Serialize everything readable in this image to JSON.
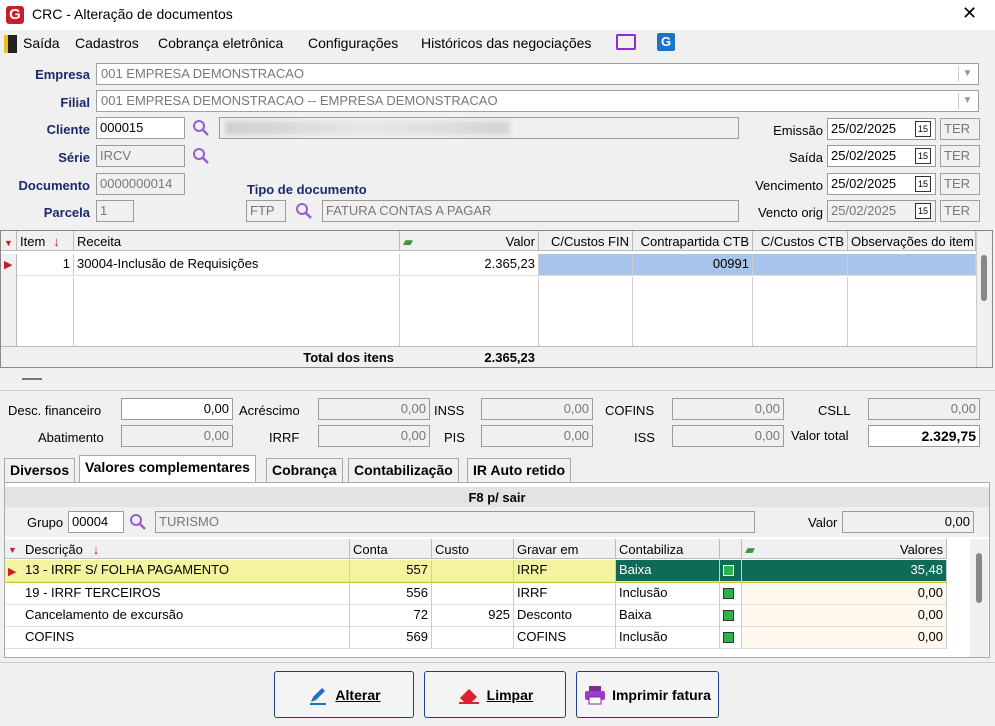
{
  "window": {
    "title": "CRC - Alteração de documentos",
    "logo": "G",
    "close": "✕"
  },
  "menu": {
    "items": [
      "Saída",
      "Cadastros",
      "Cobrança eletrônica",
      "Configurações",
      "Históricos das negociações"
    ]
  },
  "header": {
    "empresa_label": "Empresa",
    "empresa_value": "001 EMPRESA DEMONSTRACAO",
    "filial_label": "Filial",
    "filial_value": "001 EMPRESA DEMONSTRACAO -- EMPRESA DEMONSTRACAO",
    "cliente_label": "Cliente",
    "cliente_value": "000015",
    "serie_label": "Série",
    "serie_value": "IRCV",
    "documento_label": "Documento",
    "documento_value": "0000000014",
    "parcela_label": "Parcela",
    "parcela_value": "1",
    "tipo_doc_label": "Tipo de documento",
    "tipo_doc_code": "FTP",
    "tipo_doc_desc": "FATURA CONTAS A PAGAR",
    "emissao_label": "Emissão",
    "emissao_value": "25/02/2025",
    "emissao_day": "TER",
    "saida_label": "Saída",
    "saida_value": "25/02/2025",
    "saida_day": "TER",
    "vencimento_label": "Vencimento",
    "vencimento_value": "25/02/2025",
    "vencimento_day": "TER",
    "vencto_orig_label": "Vencto orig",
    "vencto_orig_value": "25/02/2025",
    "vencto_orig_day": "TER",
    "date_icon": "15"
  },
  "items_grid": {
    "columns": [
      "Item",
      "Receita",
      "Valor",
      "C/Custos FIN",
      "Contrapartida CTB",
      "C/Custos CTB",
      "Observações do item"
    ],
    "rows": [
      {
        "item": "1",
        "receita": "30004-Inclusão de Requisições",
        "valor": "2.365,23",
        "ccfin": "",
        "contrapartida": "00991",
        "ccctb": "",
        "obs": ""
      }
    ],
    "total_label": "Total dos itens",
    "total_value": "2.365,23"
  },
  "totals": {
    "desc_fin_label": "Desc. financeiro",
    "desc_fin": "0,00",
    "acrescimo_label": "Acréscimo",
    "acrescimo": "0,00",
    "inss_label": "INSS",
    "inss": "0,00",
    "cofins_label": "COFINS",
    "cofins": "0,00",
    "csll_label": "CSLL",
    "csll": "0,00",
    "abatimento_label": "Abatimento",
    "abatimento": "0,00",
    "irrf_label": "IRRF",
    "irrf": "0,00",
    "pis_label": "PIS",
    "pis": "0,00",
    "iss_label": "ISS",
    "iss": "0,00",
    "valor_total_label": "Valor total",
    "valor_total": "2.329,75"
  },
  "tabs": [
    "Diversos",
    "Valores complementares",
    "Cobrança",
    "Contabilização",
    "IR Auto retido"
  ],
  "complementares": {
    "banner": "F8 p/ sair",
    "grupo_label": "Grupo",
    "grupo_code": "00004",
    "grupo_desc": "TURISMO",
    "valor_label": "Valor",
    "valor": "0,00",
    "columns": [
      "Descrição",
      "Conta",
      "Custo",
      "Gravar em",
      "Contabiliza",
      "",
      "Valores"
    ],
    "rows": [
      {
        "descricao": "13 - IRRF S/ FOLHA PAGAMENTO",
        "conta": "557",
        "custo": "",
        "gravar": "IRRF",
        "contabiliza": "Baixa",
        "valor": "35,48"
      },
      {
        "descricao": "19 - IRRF TERCEIROS",
        "conta": "556",
        "custo": "",
        "gravar": "IRRF",
        "contabiliza": "Inclusão",
        "valor": "0,00"
      },
      {
        "descricao": "Cancelamento de excursão",
        "conta": "72",
        "custo": "925",
        "gravar": "Desconto",
        "contabiliza": "Baixa",
        "valor": "0,00"
      },
      {
        "descricao": "COFINS",
        "conta": "569",
        "custo": "",
        "gravar": "COFINS",
        "contabiliza": "Inclusão",
        "valor": "0,00"
      }
    ]
  },
  "buttons": {
    "alterar": "Alterar",
    "limpar": "Limpar",
    "imprimir": "Imprimir fatura"
  },
  "colors": {
    "label_blue": "#1a2a6b",
    "selected_row": "#a8c4ec",
    "highlight_row": "#f3f3a0",
    "green_cell": "#0e6b55",
    "accent_red": "#c8202a"
  }
}
